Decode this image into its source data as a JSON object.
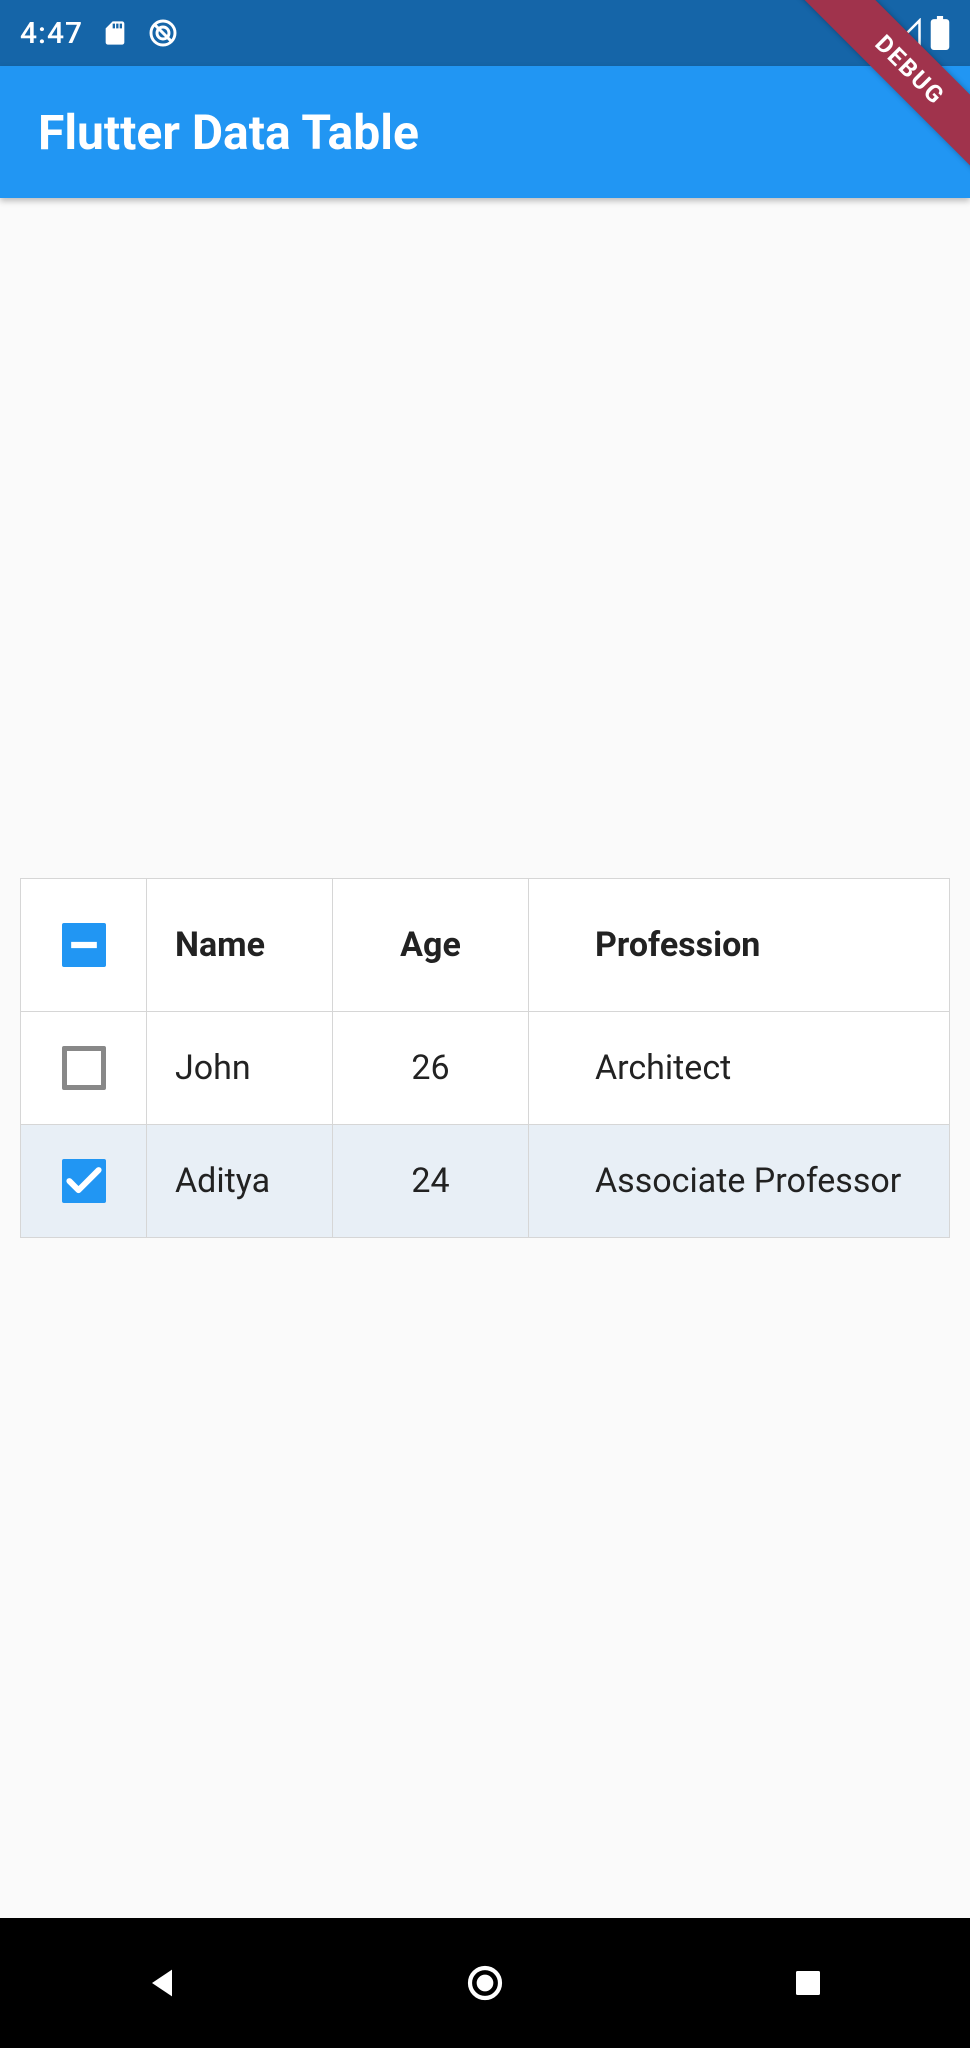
{
  "status_bar": {
    "time": "4:47"
  },
  "debug_banner": "DEBUG",
  "app_bar": {
    "title": "Flutter Data Table"
  },
  "table": {
    "header": {
      "name": "Name",
      "age": "Age",
      "profession": "Profession"
    },
    "rows": [
      {
        "selected": false,
        "name": "John",
        "age": "26",
        "profession": "Architect"
      },
      {
        "selected": true,
        "name": "Aditya",
        "age": "24",
        "profession": "Associate Professor"
      }
    ]
  },
  "colors": {
    "status_bar_bg": "#1565a8",
    "app_bar_bg": "#2196f3",
    "accent": "#2196f3",
    "selected_row_bg": "#e8eff6"
  }
}
